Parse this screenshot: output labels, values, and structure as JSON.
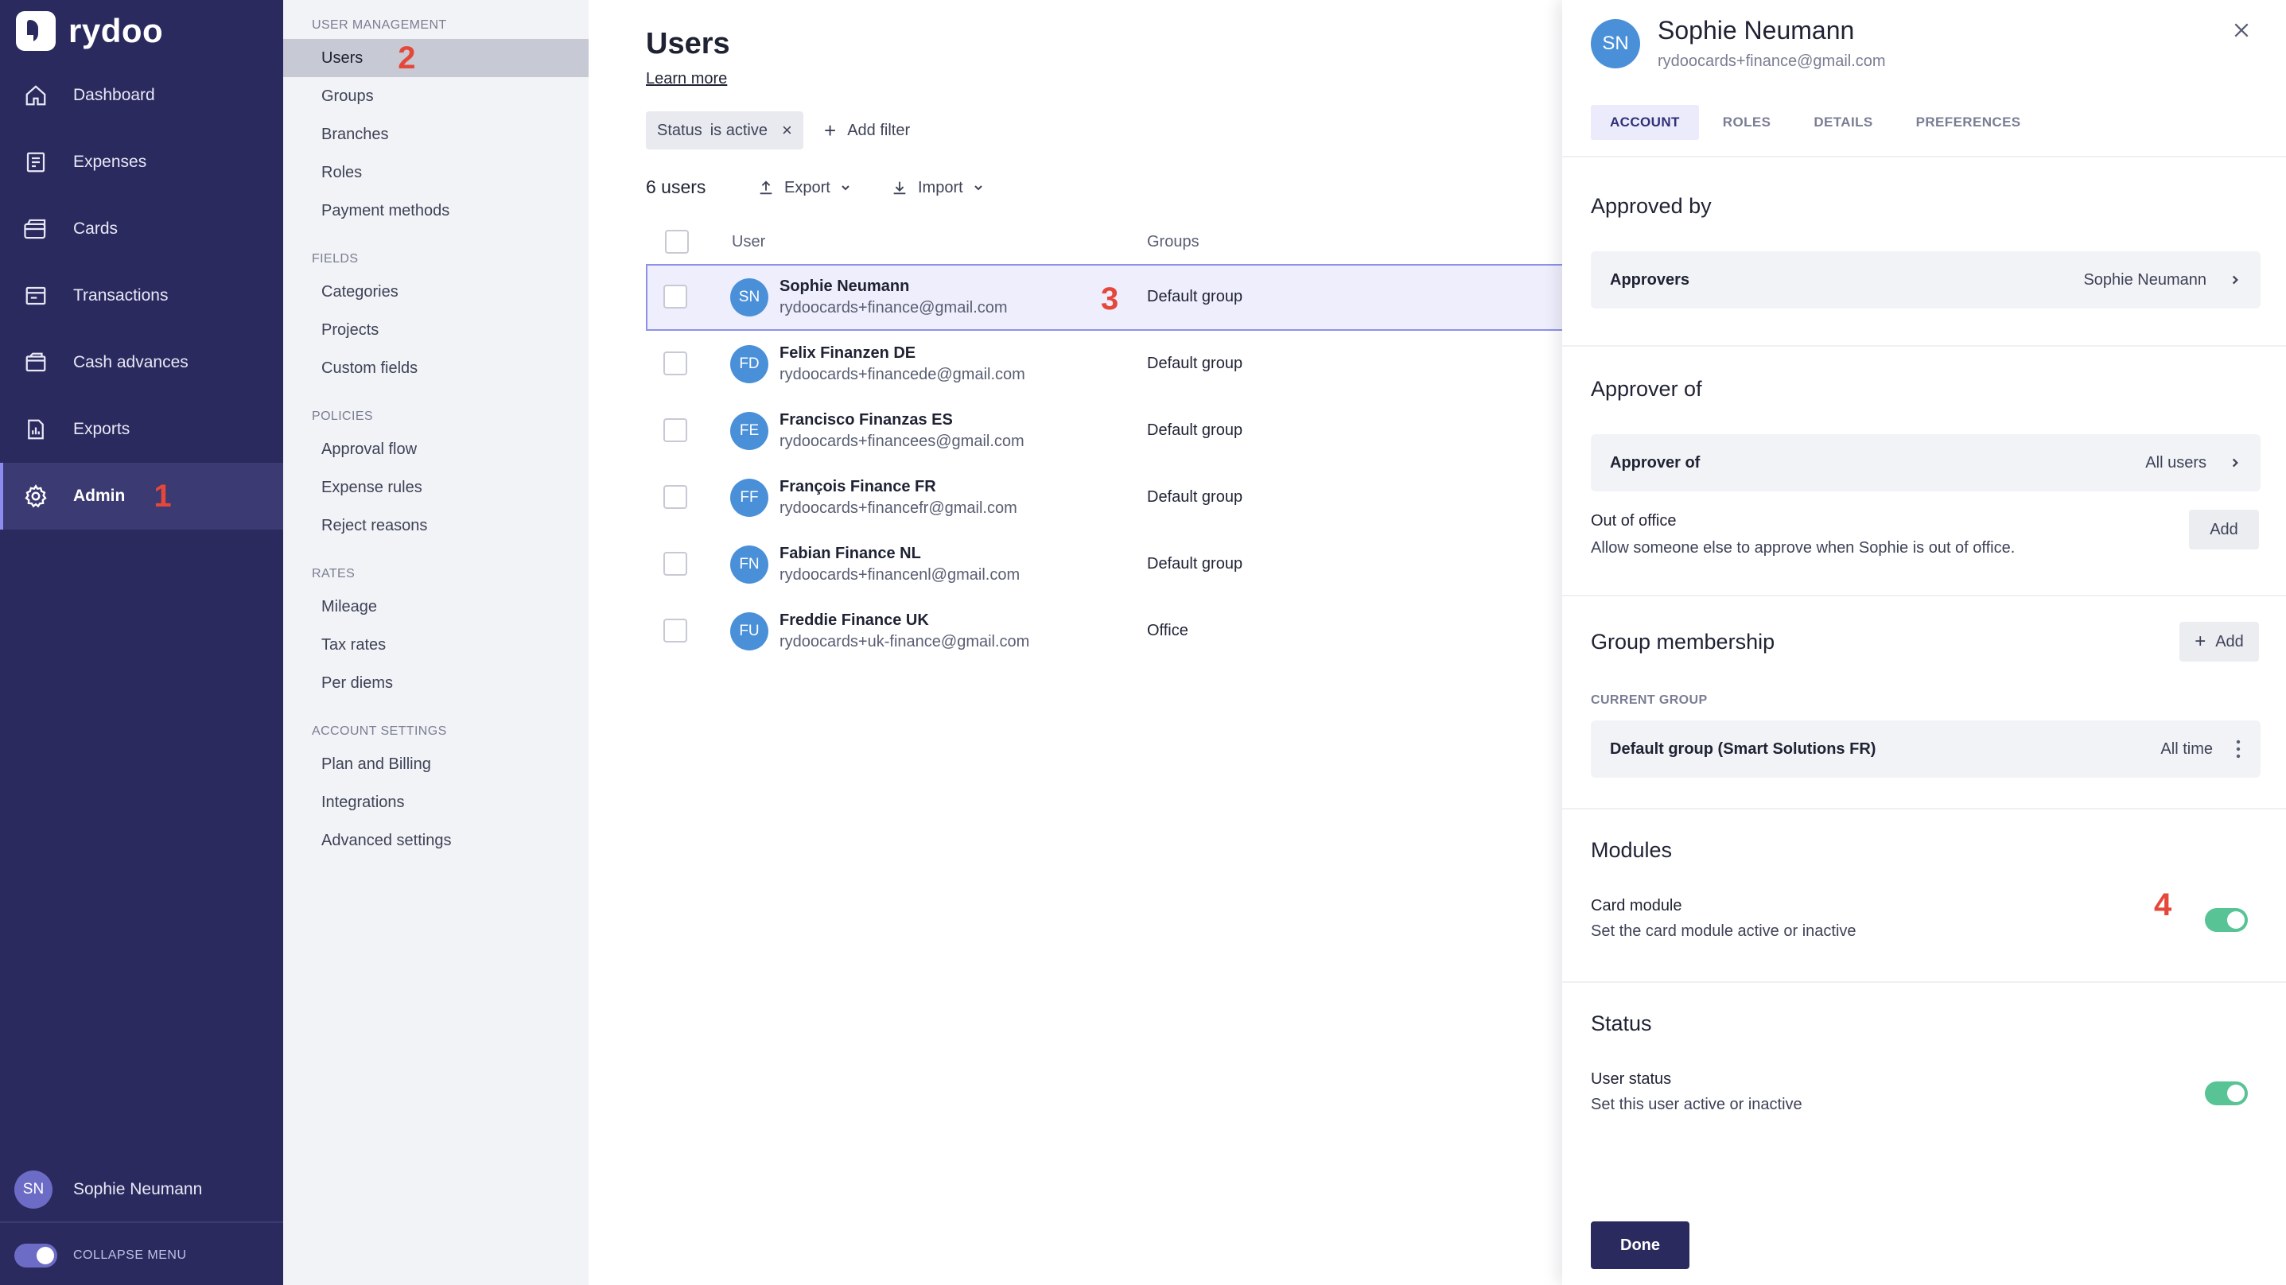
{
  "brand": {
    "name": "rydoo"
  },
  "sidebar": {
    "items": [
      {
        "label": "Dashboard",
        "icon": "home-icon"
      },
      {
        "label": "Expenses",
        "icon": "receipt-icon"
      },
      {
        "label": "Cards",
        "icon": "cards-icon"
      },
      {
        "label": "Transactions",
        "icon": "transactions-icon"
      },
      {
        "label": "Cash advances",
        "icon": "wallet-icon"
      },
      {
        "label": "Exports",
        "icon": "export-report-icon"
      },
      {
        "label": "Admin",
        "icon": "gear-icon",
        "active": true,
        "marker": "1"
      }
    ],
    "user": {
      "initials": "SN",
      "name": "Sophie Neumann"
    },
    "collapse_label": "COLLAPSE MENU"
  },
  "subnav": {
    "sections": [
      {
        "title": "USER MANAGEMENT",
        "items": [
          {
            "label": "Users",
            "active": true,
            "marker": "2"
          },
          {
            "label": "Groups"
          },
          {
            "label": "Branches"
          },
          {
            "label": "Roles"
          },
          {
            "label": "Payment methods"
          }
        ]
      },
      {
        "title": "FIELDS",
        "items": [
          {
            "label": "Categories"
          },
          {
            "label": "Projects"
          },
          {
            "label": "Custom fields"
          }
        ]
      },
      {
        "title": "POLICIES",
        "items": [
          {
            "label": "Approval flow"
          },
          {
            "label": "Expense rules"
          },
          {
            "label": "Reject reasons"
          }
        ]
      },
      {
        "title": "RATES",
        "items": [
          {
            "label": "Mileage"
          },
          {
            "label": "Tax rates"
          },
          {
            "label": "Per diems"
          }
        ]
      },
      {
        "title": "ACCOUNT SETTINGS",
        "items": [
          {
            "label": "Plan and Billing"
          },
          {
            "label": "Integrations"
          },
          {
            "label": "Advanced settings"
          }
        ]
      }
    ]
  },
  "main": {
    "title": "Users",
    "learn_more": "Learn more",
    "filter": {
      "field": "Status",
      "value": "is active",
      "remove": "×"
    },
    "add_filter": "Add filter",
    "count_label": "6 users",
    "export_label": "Export",
    "import_label": "Import",
    "columns": {
      "user": "User",
      "groups": "Groups"
    },
    "rows": [
      {
        "initials": "SN",
        "name": "Sophie Neumann",
        "email": "rydoocards+finance@gmail.com",
        "group": "Default group",
        "selected": true,
        "marker": "3"
      },
      {
        "initials": "FD",
        "name": "Felix Finanzen DE",
        "email": "rydoocards+financede@gmail.com",
        "group": "Default group"
      },
      {
        "initials": "FE",
        "name": "Francisco Finanzas ES",
        "email": "rydoocards+financees@gmail.com",
        "group": "Default group"
      },
      {
        "initials": "FF",
        "name": "François Finance FR",
        "email": "rydoocards+financefr@gmail.com",
        "group": "Default group"
      },
      {
        "initials": "FN",
        "name": "Fabian Finance NL",
        "email": "rydoocards+financenl@gmail.com",
        "group": "Default group"
      },
      {
        "initials": "FU",
        "name": "Freddie Finance UK",
        "email": "rydoocards+uk-finance@gmail.com",
        "group": "Office"
      }
    ]
  },
  "panel": {
    "initials": "SN",
    "name": "Sophie Neumann",
    "email": "rydoocards+finance@gmail.com",
    "tabs": [
      {
        "label": "ACCOUNT",
        "active": true
      },
      {
        "label": "ROLES"
      },
      {
        "label": "DETAILS"
      },
      {
        "label": "PREFERENCES"
      }
    ],
    "approved_by": {
      "title": "Approved by",
      "label": "Approvers",
      "value": "Sophie Neumann"
    },
    "approver_of": {
      "title": "Approver of",
      "label": "Approver of",
      "value": "All users"
    },
    "out_of_office": {
      "title": "Out of office",
      "desc": "Allow someone else to approve when Sophie is out of office.",
      "button": "Add"
    },
    "group_membership": {
      "title": "Group membership",
      "add": "Add",
      "caption": "CURRENT GROUP",
      "group": "Default group (Smart Solutions FR)",
      "period": "All time"
    },
    "modules": {
      "title": "Modules",
      "item_title": "Card module",
      "item_desc": "Set the card module active or inactive",
      "enabled": true,
      "marker": "4"
    },
    "status": {
      "title": "Status",
      "item_title": "User status",
      "item_desc": "Set this user active or inactive",
      "enabled": true
    },
    "done": "Done"
  },
  "colors": {
    "sidebar_bg": "#2a2a5e",
    "avatar": "#4a90d9",
    "toggle_on": "#58c495",
    "marker": "#e5483a",
    "selected_row": "#eeeefc"
  }
}
